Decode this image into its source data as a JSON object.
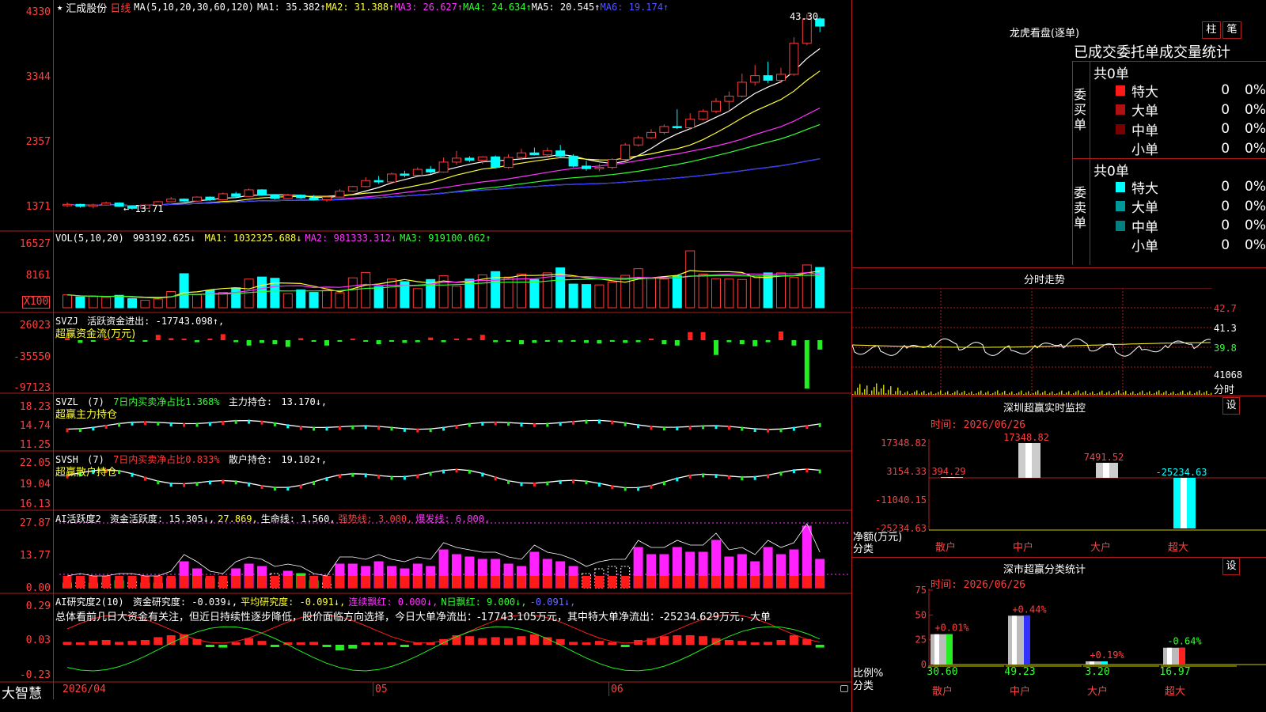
{
  "header": {
    "star_icon": "★",
    "stock_name": "汇成股份",
    "period": "日线",
    "ma_label": "MA(5,10,20,30,60,120)",
    "ma_values": [
      {
        "label": "MA1:",
        "value": "35.382↑",
        "color": "#ffffff"
      },
      {
        "label": "MA2:",
        "value": "31.388↑",
        "color": "#ffff33"
      },
      {
        "label": "MA3:",
        "value": "26.627↑",
        "color": "#ff33ff"
      },
      {
        "label": "MA4:",
        "value": "24.634↑",
        "color": "#33ff33"
      },
      {
        "label": "MA5:",
        "value": "20.545↑",
        "color": "#ffffff"
      },
      {
        "label": "MA6:",
        "value": "19.174↑",
        "color": "#5555ff"
      }
    ]
  },
  "price_panel": {
    "axis": [
      "4330",
      "3344",
      "2357",
      "1371"
    ],
    "high_label": "43.30",
    "low_label": "13.71",
    "ohlc": [
      [
        14.3,
        14.8,
        14.1,
        14.5
      ],
      [
        14.5,
        14.6,
        14.0,
        14.2
      ],
      [
        14.2,
        14.6,
        13.9,
        14.4
      ],
      [
        14.4,
        14.9,
        14.3,
        14.7
      ],
      [
        14.7,
        14.8,
        14.1,
        14.2
      ],
      [
        14.2,
        14.3,
        13.7,
        13.9
      ],
      [
        13.9,
        14.5,
        13.8,
        14.4
      ],
      [
        14.4,
        15.0,
        14.3,
        14.9
      ],
      [
        14.9,
        15.6,
        14.8,
        15.3
      ],
      [
        15.3,
        15.4,
        14.9,
        15.0
      ],
      [
        15.0,
        15.7,
        14.9,
        15.6
      ],
      [
        15.6,
        15.7,
        15.0,
        15.2
      ],
      [
        15.2,
        16.3,
        15.1,
        16.1
      ],
      [
        16.1,
        16.4,
        15.6,
        15.7
      ],
      [
        15.7,
        16.9,
        15.6,
        16.7
      ],
      [
        16.7,
        16.8,
        15.8,
        15.9
      ],
      [
        15.9,
        16.0,
        15.2,
        15.4
      ],
      [
        15.4,
        16.1,
        15.3,
        15.9
      ],
      [
        15.9,
        16.0,
        15.3,
        15.5
      ],
      [
        15.5,
        15.9,
        15.1,
        15.2
      ],
      [
        15.2,
        15.7,
        14.9,
        15.6
      ],
      [
        15.6,
        16.8,
        15.5,
        16.5
      ],
      [
        16.5,
        17.3,
        16.4,
        17.2
      ],
      [
        17.2,
        18.6,
        17.1,
        18.1
      ],
      [
        18.1,
        18.8,
        17.6,
        17.9
      ],
      [
        17.9,
        19.3,
        17.8,
        19.1
      ],
      [
        19.1,
        19.6,
        18.6,
        18.9
      ],
      [
        18.9,
        20.1,
        18.8,
        19.8
      ],
      [
        19.8,
        20.3,
        19.1,
        19.4
      ],
      [
        19.4,
        21.6,
        19.3,
        20.9
      ],
      [
        20.9,
        22.6,
        20.5,
        21.5
      ],
      [
        21.5,
        21.8,
        20.9,
        21.2
      ],
      [
        21.2,
        21.8,
        20.6,
        21.7
      ],
      [
        21.7,
        21.9,
        19.9,
        20.1
      ],
      [
        20.1,
        22.1,
        19.9,
        21.6
      ],
      [
        21.6,
        22.9,
        21.3,
        22.3
      ],
      [
        22.3,
        23.1,
        21.9,
        22.0
      ],
      [
        22.0,
        23.1,
        21.6,
        22.6
      ],
      [
        22.6,
        23.5,
        21.5,
        21.8
      ],
      [
        21.8,
        22.1,
        20.1,
        20.3
      ],
      [
        20.3,
        21.1,
        19.6,
        19.9
      ],
      [
        19.9,
        20.6,
        19.5,
        20.1
      ],
      [
        20.1,
        21.5,
        19.8,
        21.3
      ],
      [
        21.3,
        23.8,
        21.1,
        23.5
      ],
      [
        23.5,
        24.9,
        23.3,
        24.6
      ],
      [
        24.6,
        25.9,
        24.4,
        25.4
      ],
      [
        25.4,
        26.6,
        25.1,
        26.3
      ],
      [
        26.3,
        28.9,
        25.9,
        26.1
      ],
      [
        26.1,
        28.3,
        25.8,
        27.4
      ],
      [
        27.4,
        28.9,
        27.2,
        28.6
      ],
      [
        28.6,
        30.6,
        28.3,
        30.1
      ],
      [
        30.1,
        31.6,
        28.6,
        30.9
      ],
      [
        30.9,
        34.3,
        30.7,
        33.0
      ],
      [
        33.0,
        35.6,
        32.5,
        34.0
      ],
      [
        34.0,
        36.1,
        32.9,
        33.3
      ],
      [
        33.3,
        35.2,
        32.9,
        34.2
      ],
      [
        34.2,
        39.8,
        34.0,
        38.9
      ],
      [
        38.9,
        43.3,
        38.6,
        42.6
      ],
      [
        42.6,
        42.8,
        40.6,
        41.5
      ]
    ]
  },
  "vol_panel": {
    "axis": [
      "16527",
      "8161",
      "X100"
    ],
    "label": "VOL(5,10,20)",
    "value": "993192.625↓",
    "ma": [
      {
        "label": "MA1:",
        "value": "1032325.688↓",
        "color": "#ffff33"
      },
      {
        "label": "MA2:",
        "value": "981333.312↓",
        "color": "#ff33ff"
      },
      {
        "label": "MA3:",
        "value": "919100.062↑",
        "color": "#33ff33"
      }
    ],
    "values": [
      3.1,
      2.6,
      2.7,
      2.5,
      3.0,
      2.2,
      1.8,
      2.1,
      3.9,
      8.2,
      3.1,
      4.2,
      3.7,
      4.8,
      6.9,
      7.4,
      7.1,
      3.4,
      4.3,
      3.7,
      4.2,
      3.6,
      7.2,
      8.5,
      5.1,
      6.9,
      6.3,
      4.6,
      6.8,
      7.7,
      5.2,
      6.9,
      7.9,
      8.7,
      7.4,
      8.1,
      6.8,
      8.4,
      9.6,
      5.7,
      5.6,
      5.5,
      6.2,
      7.8,
      9.4,
      7.2,
      6.9,
      7.7,
      13.7,
      8.1,
      7.0,
      6.9,
      6.8,
      7.6,
      8.4,
      8.4,
      7.3,
      10.3,
      9.7
    ]
  },
  "svzj": {
    "axis": [
      "26023",
      "-35550",
      "-97123"
    ],
    "label": "SVZJ",
    "desc": "活跃资金进出: -17743.098↑,",
    "sub": "超赢资金流(万元)",
    "values": [
      3,
      -4,
      -2,
      0,
      2,
      -1,
      -1,
      8,
      3,
      0,
      -3,
      0,
      9,
      -3,
      -8,
      -4,
      -6,
      -10,
      3,
      -2,
      -8,
      -2,
      2,
      -2,
      -6,
      -1,
      -4,
      -3,
      4,
      -3,
      0,
      3,
      8,
      -3,
      -2,
      -6,
      -4,
      -2,
      -3,
      -2,
      -4,
      -5,
      -2,
      -4,
      -3,
      0,
      -6,
      -8,
      12,
      12,
      -22,
      -3,
      -6,
      -9,
      -3,
      13,
      -8,
      -72,
      -14
    ]
  },
  "svzl": {
    "axis": [
      "18.23",
      "14.74",
      "11.25"
    ],
    "label": "SVZL",
    "param": "(7)",
    "desc": "7日内买卖净占比1.368%",
    "hold_label": "主力持仓:",
    "hold_value": "13.170↓,",
    "sub": "超赢主力持仓"
  },
  "svsh": {
    "axis": [
      "22.05",
      "19.04",
      "16.13"
    ],
    "label": "SVSH",
    "param": "(7)",
    "desc": "7日内买卖净占比0.833%",
    "hold_label": "散户持仓:",
    "hold_value": "19.102↑,",
    "sub": "超赢散户持仓"
  },
  "ai_active": {
    "axis": [
      "27.87",
      "13.77",
      "0.00"
    ],
    "label": "AI活跃度2",
    "items": [
      {
        "label": "资金活跃度:",
        "value": "15.305↓,",
        "color": "#ffffff"
      },
      {
        "label": "",
        "value": "27.869,",
        "color": "#ffff33"
      },
      {
        "label": "生命线:",
        "value": "1.560,",
        "color": "#ffffff"
      },
      {
        "label": "强势线:",
        "value": "3.000,",
        "color": "#ff3b3b"
      },
      {
        "label": "爆发线:",
        "value": "6.000,",
        "color": "#ff33ff"
      }
    ],
    "values": [
      2,
      3,
      2,
      2,
      3,
      3,
      2,
      2,
      4,
      11,
      8,
      4,
      3,
      8,
      10,
      9,
      6,
      7,
      6,
      3,
      2,
      10,
      10,
      9,
      11,
      9,
      8,
      10,
      9,
      16,
      14,
      13,
      12,
      12,
      10,
      9,
      15,
      12,
      11,
      9,
      6,
      8,
      9,
      9,
      17,
      14,
      14,
      17,
      15,
      15,
      20,
      13,
      14,
      11,
      17,
      14,
      16,
      26,
      12
    ],
    "colors": [
      "g",
      "o",
      "g",
      "o",
      "g",
      "o",
      "g",
      "g",
      "m",
      "m",
      "m",
      "g",
      "o",
      "m",
      "m",
      "m",
      "o",
      "m",
      "g",
      "g",
      "o",
      "m",
      "m",
      "m",
      "m",
      "m",
      "m",
      "m",
      "m",
      "m",
      "m",
      "m",
      "m",
      "m",
      "m",
      "m",
      "m",
      "m",
      "m",
      "m",
      "o",
      "o",
      "o",
      "o",
      "m",
      "m",
      "m",
      "m",
      "m",
      "m",
      "m",
      "m",
      "m",
      "m",
      "m",
      "m",
      "m",
      "m",
      "m"
    ]
  },
  "ai_research": {
    "axis": [
      "0.29",
      "0.03",
      "-0.23"
    ],
    "label": "AI研究度2(10)",
    "items": [
      {
        "label": "资金研究度:",
        "value": "-0.039↓,",
        "color": "#ffffff"
      },
      {
        "label": "平均研究度:",
        "value": "-0.091↓,",
        "color": "#ffff33"
      },
      {
        "label": "连续飘红:",
        "value": "0.000↓,",
        "color": "#ff33ff"
      },
      {
        "label": "N日飘红:",
        "value": "9.000↓,",
        "color": "#33ff33"
      },
      {
        "label": "",
        "value": "-0.091↓,",
        "color": "#6b6bff"
      }
    ],
    "comment": "总体看前几日大资金有关注，但近日持续性逐步降低，股价面临方向选择，今日大单净流出：-17743.105万元，其中特大单净流出：-25234.629万元，大单",
    "values": [
      0.03,
      0.02,
      0.04,
      0.05,
      0.03,
      0.04,
      0.05,
      0.08,
      0.1,
      0.11,
      0.06,
      -0.01,
      -0.03,
      0.01,
      0.07,
      0.04,
      -0.01,
      0.02,
      0.01,
      0.03,
      -0.02,
      -0.06,
      -0.04,
      0.0,
      0.02,
      0.0,
      -0.01,
      0.01,
      0.02,
      0.06,
      0.1,
      0.09,
      0.07,
      0.08,
      0.07,
      0.09,
      0.11,
      0.08,
      0.06,
      0.03,
      0.02,
      0.04,
      0.02,
      -0.02,
      0.05,
      0.07,
      0.09,
      0.1,
      0.1,
      0.09,
      0.07,
      0.05,
      0.04,
      0.02,
      0.03,
      0.05,
      0.1,
      0.06,
      -0.03
    ]
  },
  "date_axis": [
    "2026/04",
    "05",
    "06"
  ],
  "brand": "大智慧",
  "lhb": {
    "title": "龙虎看盘(逐单)",
    "btn_bar": "柱",
    "btn_pen": "笔",
    "tabs": "已成交委托单成交量统计",
    "buy": {
      "side": "委买单",
      "total": "共0单",
      "rows": [
        {
          "name": "特大",
          "value": "0",
          "pct": "0%",
          "color": "#ff1a1a"
        },
        {
          "name": "大单",
          "value": "0",
          "pct": "0%",
          "color": "#b01010"
        },
        {
          "name": "中单",
          "value": "0",
          "pct": "0%",
          "color": "#7a0000"
        },
        {
          "name": "小单",
          "value": "0",
          "pct": "0%",
          "color": "#000000"
        }
      ]
    },
    "sell": {
      "side": "委卖单",
      "total": "共0单",
      "rows": [
        {
          "name": "特大",
          "value": "0",
          "pct": "0%",
          "color": "#00ffff"
        },
        {
          "name": "大单",
          "value": "0",
          "pct": "0%",
          "color": "#009999"
        },
        {
          "name": "中单",
          "value": "0",
          "pct": "0%",
          "color": "#008080"
        },
        {
          "name": "小单",
          "value": "0",
          "pct": "0%",
          "color": "#000000"
        }
      ]
    }
  },
  "intraday": {
    "title": "分时走势",
    "axis": [
      "42.7",
      "41.3",
      "39.8",
      "41068"
    ],
    "time_label": "分时"
  },
  "monitor": {
    "title": "深圳超赢实时监控",
    "btn": "设",
    "time": "时间: 2026/06/26",
    "axis": [
      "17348.82",
      "3154.33",
      "-11040.15",
      "-25234.63"
    ],
    "ylabel": "净额(万元)",
    "xlabel": "分类",
    "categories": [
      "散户",
      "中户",
      "大户",
      "超大"
    ],
    "values": [
      394.29,
      17348.82,
      7491.52,
      -25234.63
    ],
    "value_labels": [
      "394.29",
      "17348.82",
      "7491.52",
      "-25234.63"
    ]
  },
  "classify": {
    "title": "深市超赢分类统计",
    "btn": "设",
    "time": "时间: 2026/06/26",
    "axis": [
      "75",
      "50",
      "25",
      "0"
    ],
    "ylabel": "比例%",
    "xlabel": "分类",
    "categories": [
      "散户",
      "中户",
      "大户",
      "超大"
    ],
    "values": [
      30.6,
      49.23,
      3.2,
      16.97
    ],
    "value_labels": [
      "30.60",
      "49.23",
      "3.20",
      "16.97"
    ],
    "changes": [
      "+0.01%",
      "+0.44%",
      "+0.19%",
      "-0.64%"
    ]
  }
}
